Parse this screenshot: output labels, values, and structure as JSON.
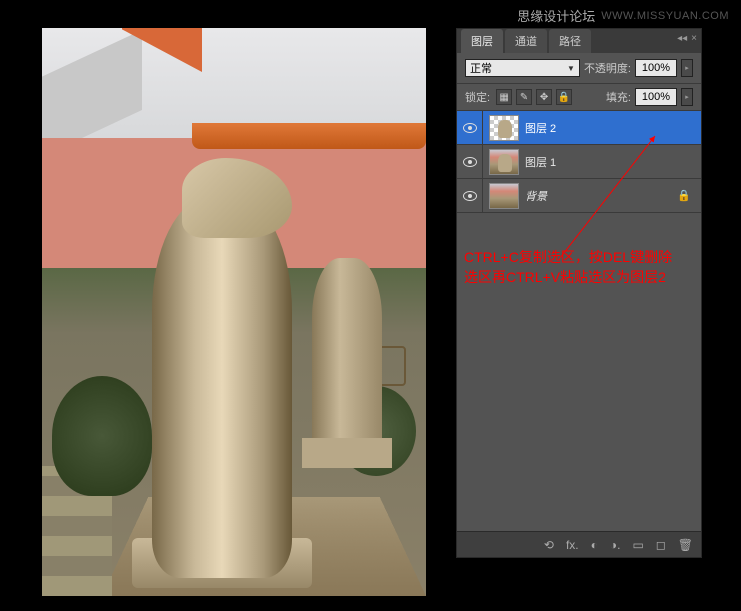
{
  "watermark": {
    "cn": "思缘设计论坛",
    "en": "WWW.MISSYUAN.COM"
  },
  "panel": {
    "tabs": {
      "layers": "图层",
      "channels": "通道",
      "paths": "路径"
    },
    "blend_mode": "正常",
    "opacity_label": "不透明度:",
    "opacity_value": "100%",
    "lock_label": "锁定:",
    "fill_label": "填充:",
    "fill_value": "100%",
    "layers": [
      {
        "name": "图层 2",
        "selected": true,
        "locked": false,
        "thumb": "checker"
      },
      {
        "name": "图层 1",
        "selected": false,
        "locked": false,
        "thumb": "image"
      },
      {
        "name": "背景",
        "selected": false,
        "locked": true,
        "thumb": "image",
        "italic": true
      }
    ],
    "footer_icons": {
      "link": "⟲",
      "fx": "fx.",
      "mask": "◐",
      "adjust": "◑.",
      "group": "▭",
      "new": "◻",
      "delete": "🗑"
    }
  },
  "annotation": {
    "line1": "CTRL+C复制选区，按DEL键删除",
    "line2": "选区再CTRL+V粘贴选区为图层2"
  }
}
